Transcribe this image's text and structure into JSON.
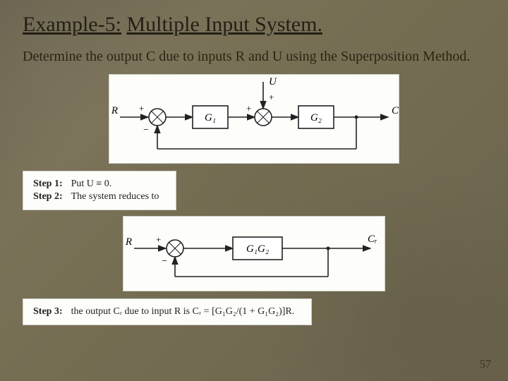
{
  "title_prefix": "Example-5:",
  "title_main": "Multiple Input System.",
  "subtitle": "Determine the output C due to inputs R and U using the Superposition Method.",
  "diagram1": {
    "R": "R",
    "U": "U",
    "C": "C",
    "G1": "G₁",
    "G2": "G₂",
    "plus": "+",
    "minus": "−"
  },
  "steps12": {
    "step1_label": "Step 1:",
    "step1_text": "Put U ≡ 0.",
    "step2_label": "Step 2:",
    "step2_text": "The system reduces to"
  },
  "diagram2": {
    "R": "R",
    "CR": "Cᵣ",
    "G1G2": "G₁G₂",
    "plus": "+",
    "minus": "−"
  },
  "step3": {
    "label": "Step 3:",
    "text": "the output Cᵣ due to input R is Cᵣ = [G₁G₂/(1 + G₁G₂)]R."
  },
  "page_number": "57"
}
